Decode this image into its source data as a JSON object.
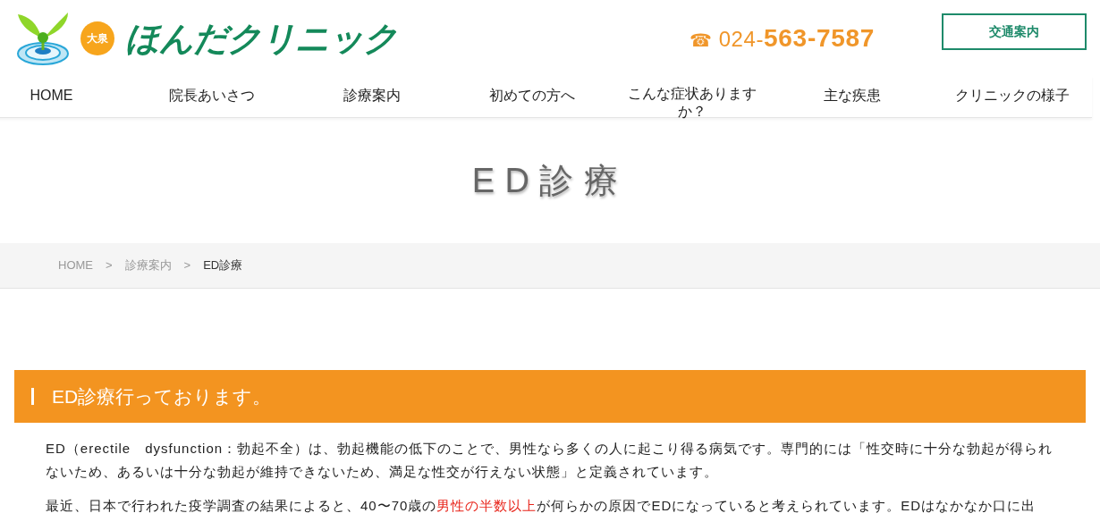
{
  "header": {
    "logo": {
      "badge": "大泉",
      "name": "ほんだクリニック"
    },
    "phone": {
      "icon": "☎",
      "prefix": "024-",
      "number": "563-7587"
    },
    "access_button": "交通案内"
  },
  "nav": [
    {
      "label": "HOME"
    },
    {
      "label": "院長あいさつ"
    },
    {
      "label": "診療案内"
    },
    {
      "label": "初めての方へ"
    },
    {
      "label": "こんな症状ありますか？"
    },
    {
      "label": "主な疾患"
    },
    {
      "label": "クリニックの様子"
    }
  ],
  "page_title": "ED診療",
  "breadcrumb": [
    {
      "label": "HOME",
      "current": false
    },
    {
      "label": "診療案内",
      "current": false
    },
    {
      "label": "ED診療",
      "current": true
    }
  ],
  "breadcrumb_separator": ">",
  "section": {
    "heading": "ED診療行っております。",
    "paragraphs": [
      [
        {
          "text": "ED（erectile　dysfunction：勃起不全）は、勃起機能の低下のことで、男性なら多くの人に起こり得る病気です。専門的には「性交時に十分な勃起が得られないため、あるいは十分な勃起が維持できないため、満足な性交が行えない状態」と定義されています。",
          "emphasis": false
        }
      ],
      [
        {
          "text": "最近、日本で行われた疫学調査の結果によると、40〜70歳の",
          "emphasis": false
        },
        {
          "text": "男性の半数以上",
          "emphasis": true
        },
        {
          "text": "が何らかの原因でEDになっていると考えられています。EDはなかなか口に出",
          "emphasis": false
        }
      ]
    ]
  }
}
